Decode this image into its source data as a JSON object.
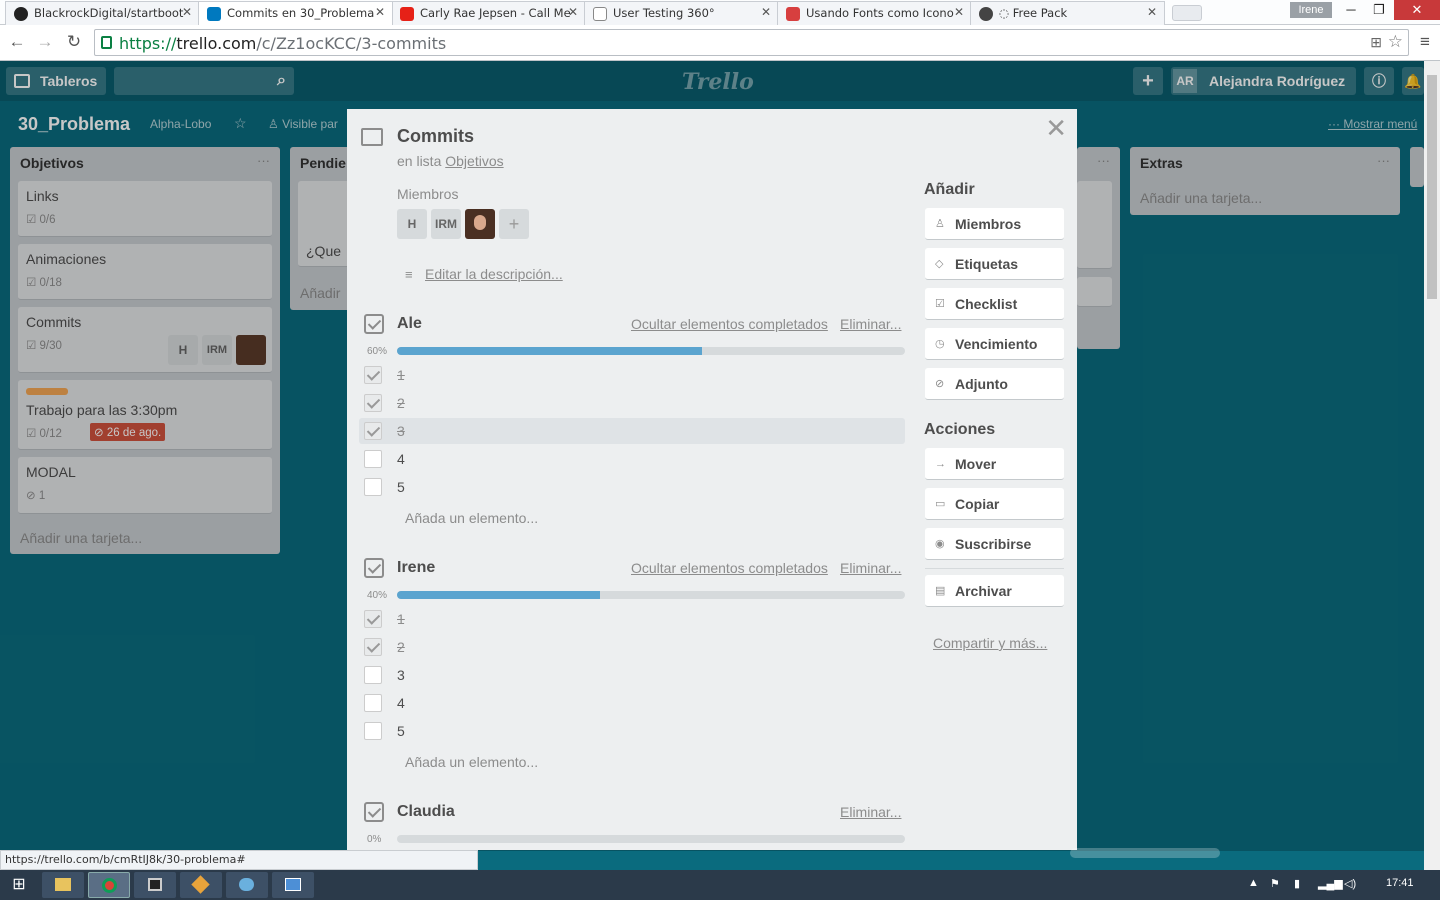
{
  "browser": {
    "tabs": [
      {
        "label": "BlackrockDigital/startboot",
        "favicon_color": "#222222"
      },
      {
        "label": "Commits en 30_Problema",
        "favicon_color": "#0079bf"
      },
      {
        "label": "Carly Rae Jepsen - Call Me",
        "favicon_color": "#e62117"
      },
      {
        "label": "User Testing 360°",
        "favicon_color": "#888888"
      },
      {
        "label": "Usando Fonts como Icono",
        "favicon_color": "#d73f3f"
      },
      {
        "label": "◌ Free Pack",
        "favicon_color": "#444444"
      }
    ],
    "profile_name": "Irene",
    "url_scheme": "https://",
    "url_host": "trello.com",
    "url_path": "/c/Zz1ocKCC/3-commits",
    "status_url": "https://trello.com/b/cmRtIJ8k/30-problema#"
  },
  "header": {
    "boards_label": "Tableros",
    "logo_text": "Trello",
    "add_label": "+",
    "user_initials": "AR",
    "user_name": "Alejandra Rodríguez"
  },
  "board": {
    "title": "30_Problema",
    "team": "Alpha-Lobo",
    "visibility": "Visible par",
    "show_menu": "Mostrar menú"
  },
  "lists": {
    "objetivos": {
      "title": "Objetivos",
      "cards": [
        {
          "title": "Links",
          "badge": "0/6"
        },
        {
          "title": "Animaciones",
          "badge": "0/18"
        },
        {
          "title": "Commits",
          "badge": "9/30",
          "members": [
            "H",
            "IRM"
          ]
        },
        {
          "title": "Trabajo para las 3:30pm",
          "badge": "0/12",
          "due": "26 de ago.",
          "label_color": "#f2a654"
        },
        {
          "title": "MODAL",
          "badge": "1"
        }
      ],
      "add_card": "Añadir una tarjeta..."
    },
    "pendientes": {
      "title": "Pendie",
      "card_snippet": "¿Que",
      "add_card": "Añadir"
    },
    "extras": {
      "title": "Extras",
      "add_card": "Añadir una tarjeta..."
    }
  },
  "modal": {
    "title": "Commits",
    "in_list_prefix": "en lista",
    "in_list_name": "Objetivos",
    "members_label": "Miembros",
    "members": [
      "H",
      "IRM"
    ],
    "add_member": "+",
    "edit_description": "Editar la descripción...",
    "checklists": [
      {
        "title": "Ale",
        "progress": 60,
        "progress_label": "60%",
        "hide_label": "Ocultar elementos completados",
        "delete_label": "Eliminar...",
        "items": [
          {
            "text": "1",
            "done": true
          },
          {
            "text": "2",
            "done": true
          },
          {
            "text": "3",
            "done": true,
            "highlighted": true
          },
          {
            "text": "4",
            "done": false
          },
          {
            "text": "5",
            "done": false
          }
        ],
        "add_item": "Añada un elemento..."
      },
      {
        "title": "Irene",
        "progress": 40,
        "progress_label": "40%",
        "hide_label": "Ocultar elementos completados",
        "delete_label": "Eliminar...",
        "items": [
          {
            "text": "1",
            "done": true
          },
          {
            "text": "2",
            "done": true
          },
          {
            "text": "3",
            "done": false
          },
          {
            "text": "4",
            "done": false
          },
          {
            "text": "5",
            "done": false
          }
        ],
        "add_item": "Añada un elemento..."
      },
      {
        "title": "Claudia",
        "progress": 0,
        "progress_label": "0%",
        "delete_label": "Eliminar..."
      }
    ],
    "sidebar": {
      "add_heading": "Añadir",
      "add_buttons": [
        "Miembros",
        "Etiquetas",
        "Checklist",
        "Vencimiento",
        "Adjunto"
      ],
      "actions_heading": "Acciones",
      "action_buttons": [
        "Mover",
        "Copiar",
        "Suscribirse"
      ],
      "archive": "Archivar",
      "share": "Compartir y más..."
    }
  },
  "taskbar": {
    "clock": "17:41"
  },
  "colors": {
    "board_bg": "#0a6b7e",
    "progress": "#5ba4cf",
    "due_badge": "#cf513d"
  }
}
